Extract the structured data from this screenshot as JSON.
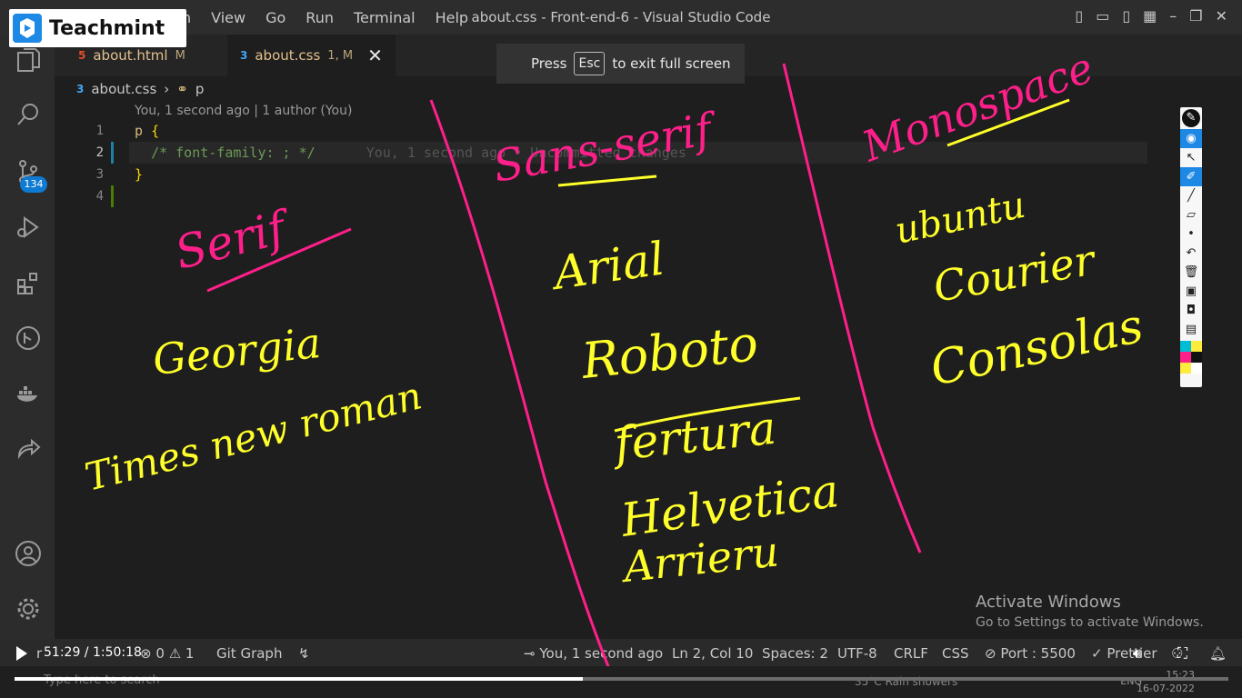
{
  "brand": {
    "name": "Teachmint"
  },
  "menu": {
    "items": [
      "n",
      "View",
      "Go",
      "Run",
      "Terminal",
      "Help"
    ]
  },
  "window": {
    "title": "about.css - Front-end-6 - Visual Studio Code"
  },
  "fullscreen_toast": {
    "press": "Press",
    "key": "Esc",
    "rest": "to exit full screen"
  },
  "tabs": [
    {
      "file": "about.html",
      "icon": "html5-icon",
      "status": "M"
    },
    {
      "file": "about.css",
      "icon": "css3-icon",
      "status": "1, M"
    }
  ],
  "activity": {
    "scm_badge": "134"
  },
  "breadcrumb": {
    "file": "about.css",
    "symbol": "p"
  },
  "codelens": {
    "text": "You, 1 second ago | 1 author (You)"
  },
  "code": {
    "line_numbers": [
      "1",
      "2",
      "3",
      "4"
    ],
    "line1_selector": "p",
    "line1_brace": "{",
    "line2_comment": "/* font-family: ; */",
    "line2_blame": "You, 1 second ago • Uncommitted changes",
    "line3_brace": "}"
  },
  "annotations": {
    "serif_heading": "Serif",
    "serif_fonts": [
      "Georgia",
      "Times new roman"
    ],
    "sans_heading": "Sans-serif",
    "sans_fonts": [
      "Arial",
      "Roboto",
      "fertura",
      "Helvetica",
      "Arrieru"
    ],
    "mono_heading": "Monospace",
    "mono_fonts": [
      "ubuntu",
      "Courier",
      "Consolas"
    ],
    "pen_colors": {
      "headings": "#ff1f8a",
      "fonts": "#ffff2a"
    }
  },
  "activate_windows": {
    "title": "Activate Windows",
    "subtitle": "Go to Settings to activate Windows."
  },
  "statusbar": {
    "branch": "r",
    "errors": "0",
    "warnings": "1",
    "git_graph": "Git Graph",
    "blame": "You, 1 second ago",
    "position": "Ln 2, Col 10",
    "spaces": "Spaces: 2",
    "encoding": "UTF-8",
    "eol": "CRLF",
    "language": "CSS",
    "port": "Port : 5500",
    "prettier": "Prettier"
  },
  "video": {
    "time": "51:29 / 1:50:18",
    "progress": 0.468
  },
  "taskbar": {
    "search_placeholder": "Type here to search",
    "weather": "35°C  Rain showers",
    "lang": "ENG",
    "time": "15:23",
    "date": "16-07-2022"
  }
}
